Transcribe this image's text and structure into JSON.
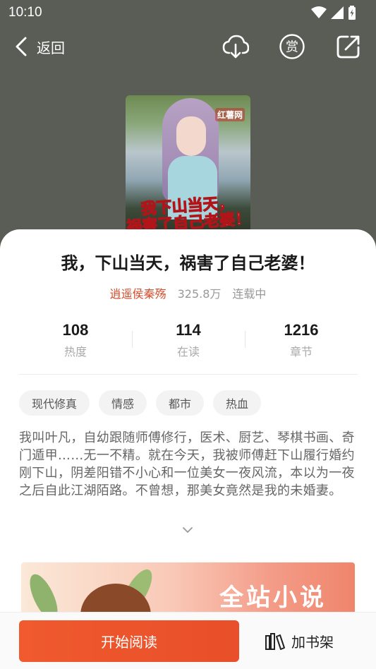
{
  "status_bar": {
    "time": "10:10"
  },
  "nav": {
    "back_label": "返回"
  },
  "cover": {
    "logo": "红薯网",
    "title_line1": "我下山当天，",
    "title_line2": "祸害了自己老婆！"
  },
  "book": {
    "title": "我，下山当天，祸害了自己老婆！",
    "author": "逍遥侯秦殇",
    "word_count": "325.8万",
    "status": "连载中"
  },
  "stats": [
    {
      "value": "108",
      "label": "热度"
    },
    {
      "value": "114",
      "label": "在读"
    },
    {
      "value": "1216",
      "label": "章节"
    }
  ],
  "tags": [
    "现代修真",
    "情感",
    "都市",
    "热血"
  ],
  "description": "我叫叶凡，自幼跟随师傅修行，医术、厨艺、琴棋书画、奇门遁甲……无一不精。就在今天，我被师傅赶下山履行婚约刚下山，阴差阳错不小心和一位美女一夜风流，本以为一夜之后自此江湖陌路。不曾想，那美女竟然是我的未婚妻。",
  "banner": {
    "text": "全站小说"
  },
  "bottom": {
    "read_label": "开始阅读",
    "shelf_label": "加书架"
  },
  "colors": {
    "accent": "#e84f2a",
    "header_bg": "#595d55",
    "author": "#d34b2a"
  }
}
